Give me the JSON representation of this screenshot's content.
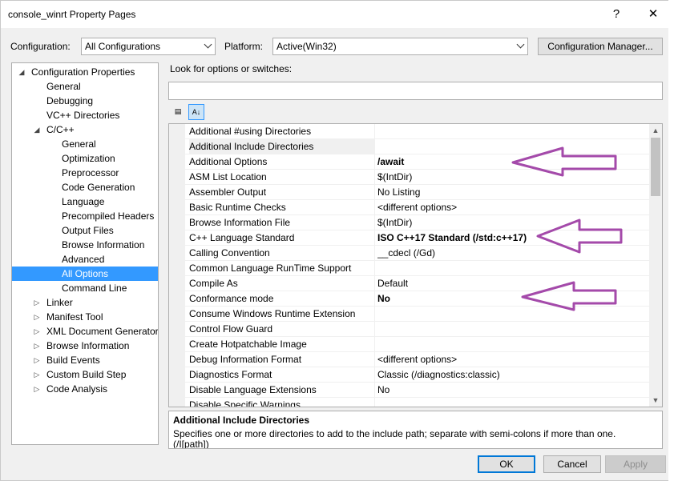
{
  "window": {
    "title": "console_winrt Property Pages",
    "help_glyph": "?",
    "close_glyph": "✕"
  },
  "toolbar": {
    "configuration_label": "Configuration:",
    "configuration_value": "All Configurations",
    "platform_label": "Platform:",
    "platform_value": "Active(Win32)",
    "config_manager_label": "Configuration Manager..."
  },
  "tree": {
    "items": [
      {
        "label": "Configuration Properties",
        "expander": "◢"
      },
      {
        "label": "General",
        "expander": ""
      },
      {
        "label": "Debugging",
        "expander": ""
      },
      {
        "label": "VC++ Directories",
        "expander": ""
      },
      {
        "label": "C/C++",
        "expander": "◢"
      },
      {
        "label": "General",
        "expander": ""
      },
      {
        "label": "Optimization",
        "expander": ""
      },
      {
        "label": "Preprocessor",
        "expander": ""
      },
      {
        "label": "Code Generation",
        "expander": ""
      },
      {
        "label": "Language",
        "expander": ""
      },
      {
        "label": "Precompiled Headers",
        "expander": ""
      },
      {
        "label": "Output Files",
        "expander": ""
      },
      {
        "label": "Browse Information",
        "expander": ""
      },
      {
        "label": "Advanced",
        "expander": ""
      },
      {
        "label": "All Options",
        "expander": ""
      },
      {
        "label": "Command Line",
        "expander": ""
      },
      {
        "label": "Linker",
        "expander": "▷"
      },
      {
        "label": "Manifest Tool",
        "expander": "▷"
      },
      {
        "label": "XML Document Generator",
        "expander": "▷"
      },
      {
        "label": "Browse Information",
        "expander": "▷"
      },
      {
        "label": "Build Events",
        "expander": "▷"
      },
      {
        "label": "Custom Build Step",
        "expander": "▷"
      },
      {
        "label": "Code Analysis",
        "expander": "▷"
      }
    ]
  },
  "search": {
    "label": "Look for options or switches:",
    "value": ""
  },
  "view_buttons": {
    "categorized_glyph": "▤",
    "alphabetical_glyph": "A↓"
  },
  "grid": {
    "rows": [
      {
        "name": "Additional #using Directories",
        "value": ""
      },
      {
        "name": "Additional Include Directories",
        "value": ""
      },
      {
        "name": "Additional Options",
        "value": "/await"
      },
      {
        "name": "ASM List Location",
        "value": "$(IntDir)"
      },
      {
        "name": "Assembler Output",
        "value": "No Listing"
      },
      {
        "name": "Basic Runtime Checks",
        "value": "<different options>"
      },
      {
        "name": "Browse Information File",
        "value": "$(IntDir)"
      },
      {
        "name": "C++ Language Standard",
        "value": "ISO C++17 Standard (/std:c++17)"
      },
      {
        "name": "Calling Convention",
        "value": "__cdecl (/Gd)"
      },
      {
        "name": "Common Language RunTime Support",
        "value": ""
      },
      {
        "name": "Compile As",
        "value": "Default"
      },
      {
        "name": "Conformance mode",
        "value": "No"
      },
      {
        "name": "Consume Windows Runtime Extension",
        "value": ""
      },
      {
        "name": "Control Flow Guard",
        "value": ""
      },
      {
        "name": "Create Hotpatchable Image",
        "value": ""
      },
      {
        "name": "Debug Information Format",
        "value": "<different options>"
      },
      {
        "name": "Diagnostics Format",
        "value": "Classic (/diagnostics:classic)"
      },
      {
        "name": "Disable Language Extensions",
        "value": "No"
      },
      {
        "name": "Disable Specific Warnings",
        "value": ""
      }
    ]
  },
  "description": {
    "title": "Additional Include Directories",
    "text": "Specifies one or more directories to add to the include path; separate with semi-colons if more than one.",
    "syntax": "(/I[path])"
  },
  "buttons": {
    "ok": "OK",
    "cancel": "Cancel",
    "apply": "Apply"
  },
  "colors": {
    "annotation_arrow": "#a44aaa",
    "selection": "#3399ff"
  }
}
